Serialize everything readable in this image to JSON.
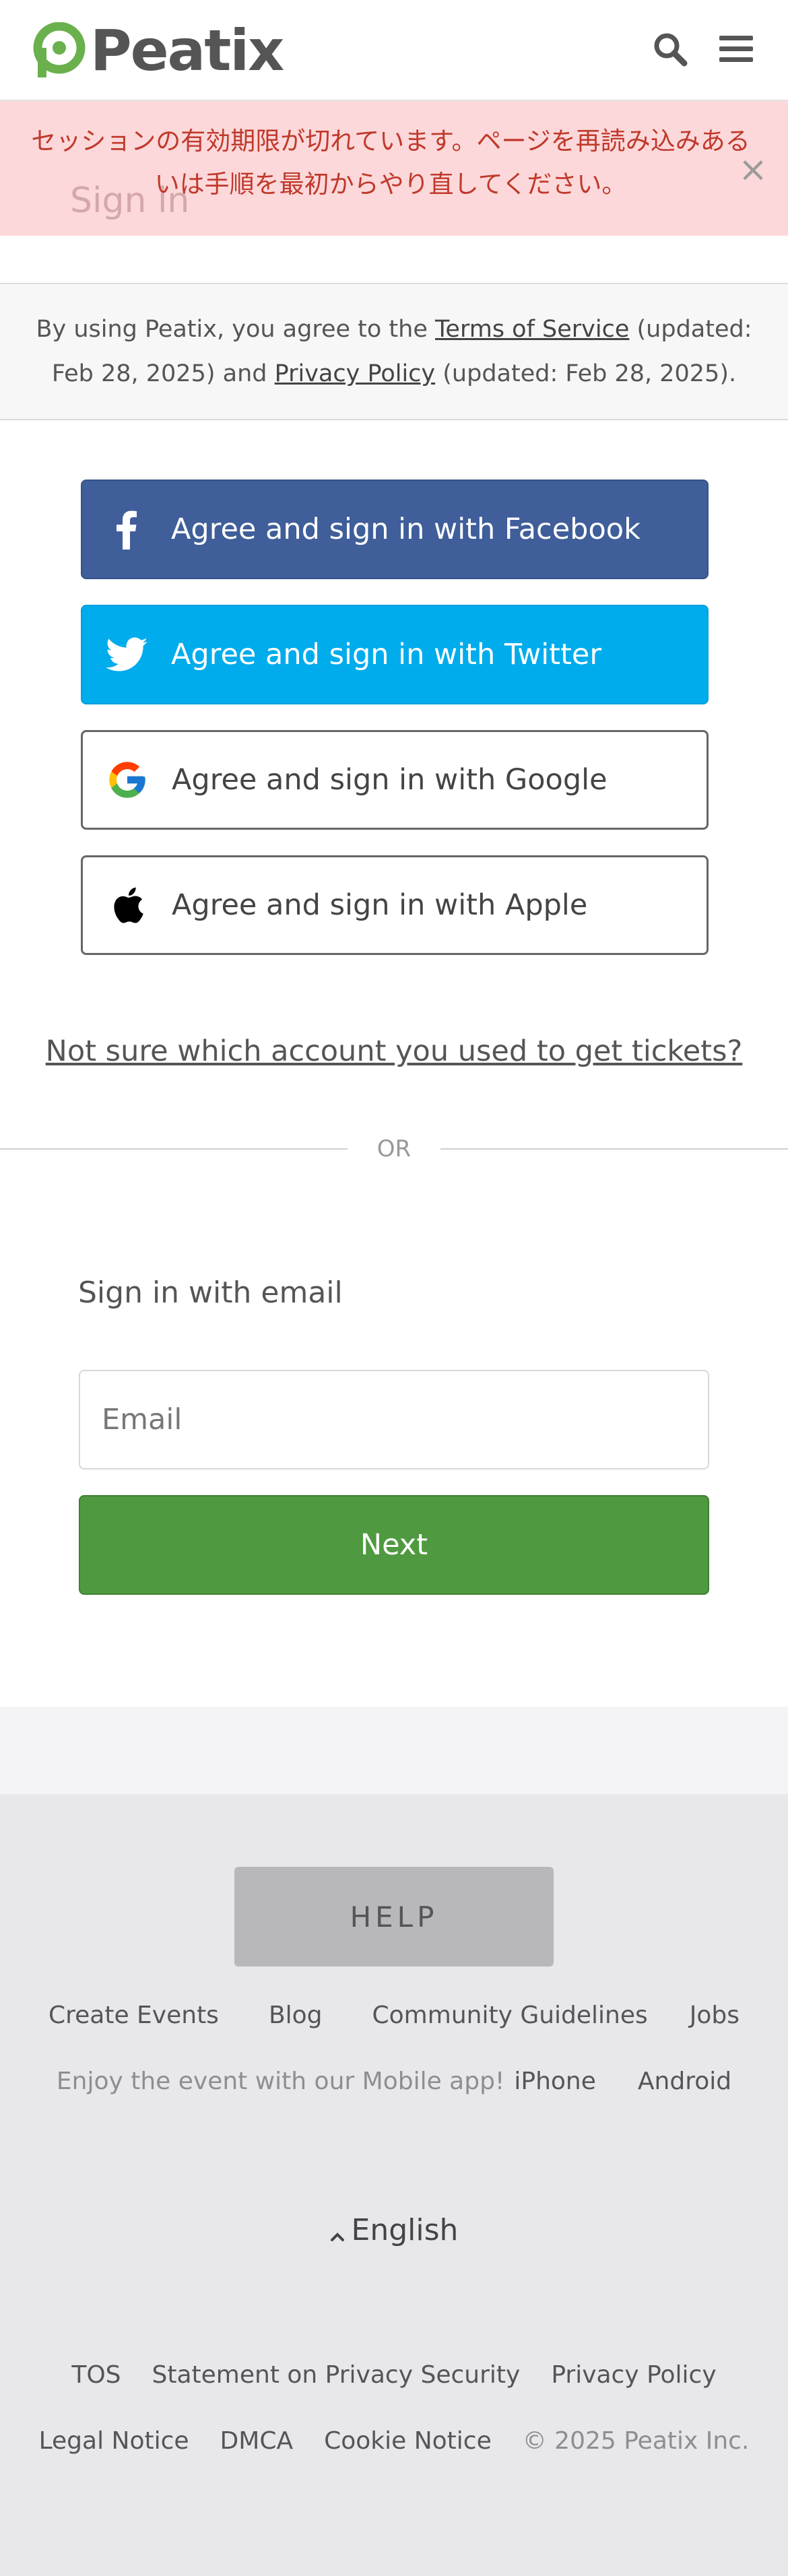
{
  "header": {
    "logo_text": "Peatix",
    "search_icon": "search-icon",
    "menu_icon": "hamburger-menu-icon",
    "brand_color": "#6ab04c"
  },
  "flash": {
    "message": "セッションの有効期限が切れています。ページを再読み込みあるいは手順を最初からやり直してください。",
    "close_label": "×"
  },
  "page_title": "Sign in",
  "terms": {
    "prefix": "By using Peatix, you agree to the ",
    "tos_link": "Terms of Service",
    "tos_updated": " (updated: Feb 28, 2025) and ",
    "privacy_link": "Privacy Policy",
    "privacy_updated": " (updated: Feb 28, 2025)."
  },
  "social": {
    "facebook": "Agree and sign in with Facebook",
    "twitter": "Agree and sign in with Twitter",
    "google": "Agree and sign in with Google",
    "apple": "Agree and sign in with Apple"
  },
  "not_sure_link": "Not sure which account you used to get tickets?",
  "divider": "OR",
  "email_section": {
    "heading": "Sign in with email",
    "placeholder": "Email",
    "next_label": "Next"
  },
  "footer": {
    "help_label": "HELP",
    "links1": [
      "Create Events",
      "Blog",
      "Community Guidelines",
      "Jobs"
    ],
    "app_text": "Enjoy the event with our Mobile app!",
    "iphone": "iPhone",
    "android": "Android",
    "language": "English",
    "links2": [
      "TOS",
      "Statement on Privacy Security",
      "Privacy Policy"
    ],
    "links3": [
      "Legal Notice",
      "DMCA",
      "Cookie Notice"
    ],
    "copyright": "© 2025 Peatix Inc."
  }
}
